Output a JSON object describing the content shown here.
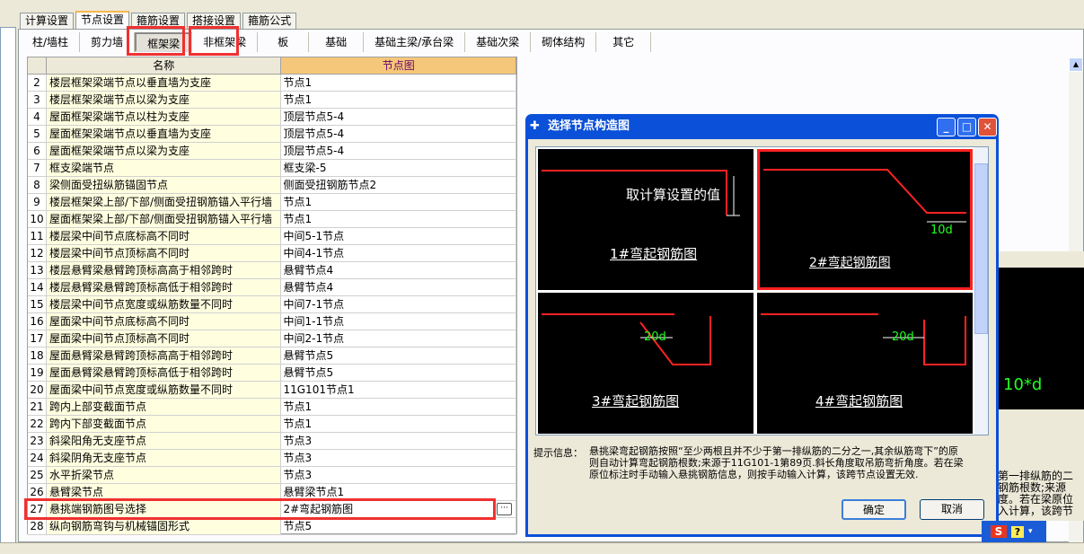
{
  "tabs": [
    "计算设置",
    "节点设置",
    "箍筋设置",
    "搭接设置",
    "箍筋公式"
  ],
  "subtabs": [
    "柱/墙柱",
    "剪力墙",
    "框架梁",
    "非框架梁",
    "板",
    "基础",
    "基础主梁/承台梁",
    "基础次梁",
    "砌体结构",
    "其它"
  ],
  "grid": {
    "headers": [
      "名称",
      "节点图"
    ],
    "rows": [
      [
        "2",
        "楼层框架梁端节点以垂直墙为支座",
        "节点1"
      ],
      [
        "3",
        "楼层框架梁端节点以梁为支座",
        "节点1"
      ],
      [
        "4",
        "屋面框架梁端节点以柱为支座",
        "顶层节点5-4"
      ],
      [
        "5",
        "屋面框架梁端节点以垂直墙为支座",
        "顶层节点5-4"
      ],
      [
        "6",
        "屋面框架梁端节点以梁为支座",
        "顶层节点5-4"
      ],
      [
        "7",
        "框支梁端节点",
        "框支梁-5"
      ],
      [
        "8",
        "梁侧面受扭纵筋锚固节点",
        "侧面受扭钢筋节点2"
      ],
      [
        "9",
        "楼层框架梁上部/下部/侧面受扭钢筋锚入平行墙",
        "节点1"
      ],
      [
        "10",
        "屋面框架梁上部/下部/侧面受扭钢筋锚入平行墙",
        "节点1"
      ],
      [
        "11",
        "楼层梁中间节点底标高不同时",
        "中间5-1节点"
      ],
      [
        "12",
        "楼层梁中间节点顶标高不同时",
        "中间4-1节点"
      ],
      [
        "13",
        "楼层悬臂梁悬臂跨顶标高高于相邻跨时",
        "悬臂节点4"
      ],
      [
        "14",
        "楼层悬臂梁悬臂跨顶标高低于相邻跨时",
        "悬臂节点4"
      ],
      [
        "15",
        "楼层梁中间节点宽度或纵筋数量不同时",
        "中间7-1节点"
      ],
      [
        "16",
        "屋面梁中间节点底标高不同时",
        "中间1-1节点"
      ],
      [
        "17",
        "屋面梁中间节点顶标高不同时",
        "中间2-1节点"
      ],
      [
        "18",
        "屋面悬臂梁悬臂跨顶标高高于相邻跨时",
        "悬臂节点5"
      ],
      [
        "19",
        "屋面悬臂梁悬臂跨顶标高低于相邻跨时",
        "悬臂节点5"
      ],
      [
        "20",
        "屋面梁中间节点宽度或纵筋数量不同时",
        "11G101节点1"
      ],
      [
        "21",
        "跨内上部变截面节点",
        "节点1"
      ],
      [
        "22",
        "跨内下部变截面节点",
        "节点1"
      ],
      [
        "23",
        "斜梁阳角无支座节点",
        "节点3"
      ],
      [
        "24",
        "斜梁阴角无支座节点",
        "节点3"
      ],
      [
        "25",
        "水平折梁节点",
        "节点3"
      ],
      [
        "26",
        "悬臂梁节点",
        "悬臂梁节点1"
      ],
      [
        "27",
        "悬挑端钢筋图号选择",
        "2#弯起钢筋图"
      ],
      [
        "28",
        "纵向钢筋弯钩与机械锚固形式",
        "节点5"
      ]
    ]
  },
  "dialog": {
    "title": "选择节点构造图",
    "cells": [
      {
        "caption": "1#弯起钢筋图",
        "note": "取计算设置的值"
      },
      {
        "caption": "2#弯起钢筋图",
        "note": "10d"
      },
      {
        "caption": "3#弯起钢筋图",
        "note": "20d"
      },
      {
        "caption": "4#弯起钢筋图",
        "note": "20d"
      }
    ],
    "hint_label": "提示信息：",
    "hint": "悬挑梁弯起钢筋按照“至少两根且并不少于第一排纵筋的二分之一,其余纵筋弯下”的原则自动计算弯起钢筋根数;来源于11G101-1第89页.斜长角度取吊筋弯折角度。若在梁原位标注时手动输入悬挑钢筋信息，则按手动输入计算，该跨节点设置无效.",
    "ok": "确定",
    "cancel": "取消"
  },
  "background_window": {
    "label": "10*d",
    "text": "第一排纵筋的二\n钢筋根数;来源\n度。若在梁原位\n入计算，该跨节"
  },
  "ime": {
    "logo": "S",
    "help": "?"
  },
  "ellipsis": "···"
}
